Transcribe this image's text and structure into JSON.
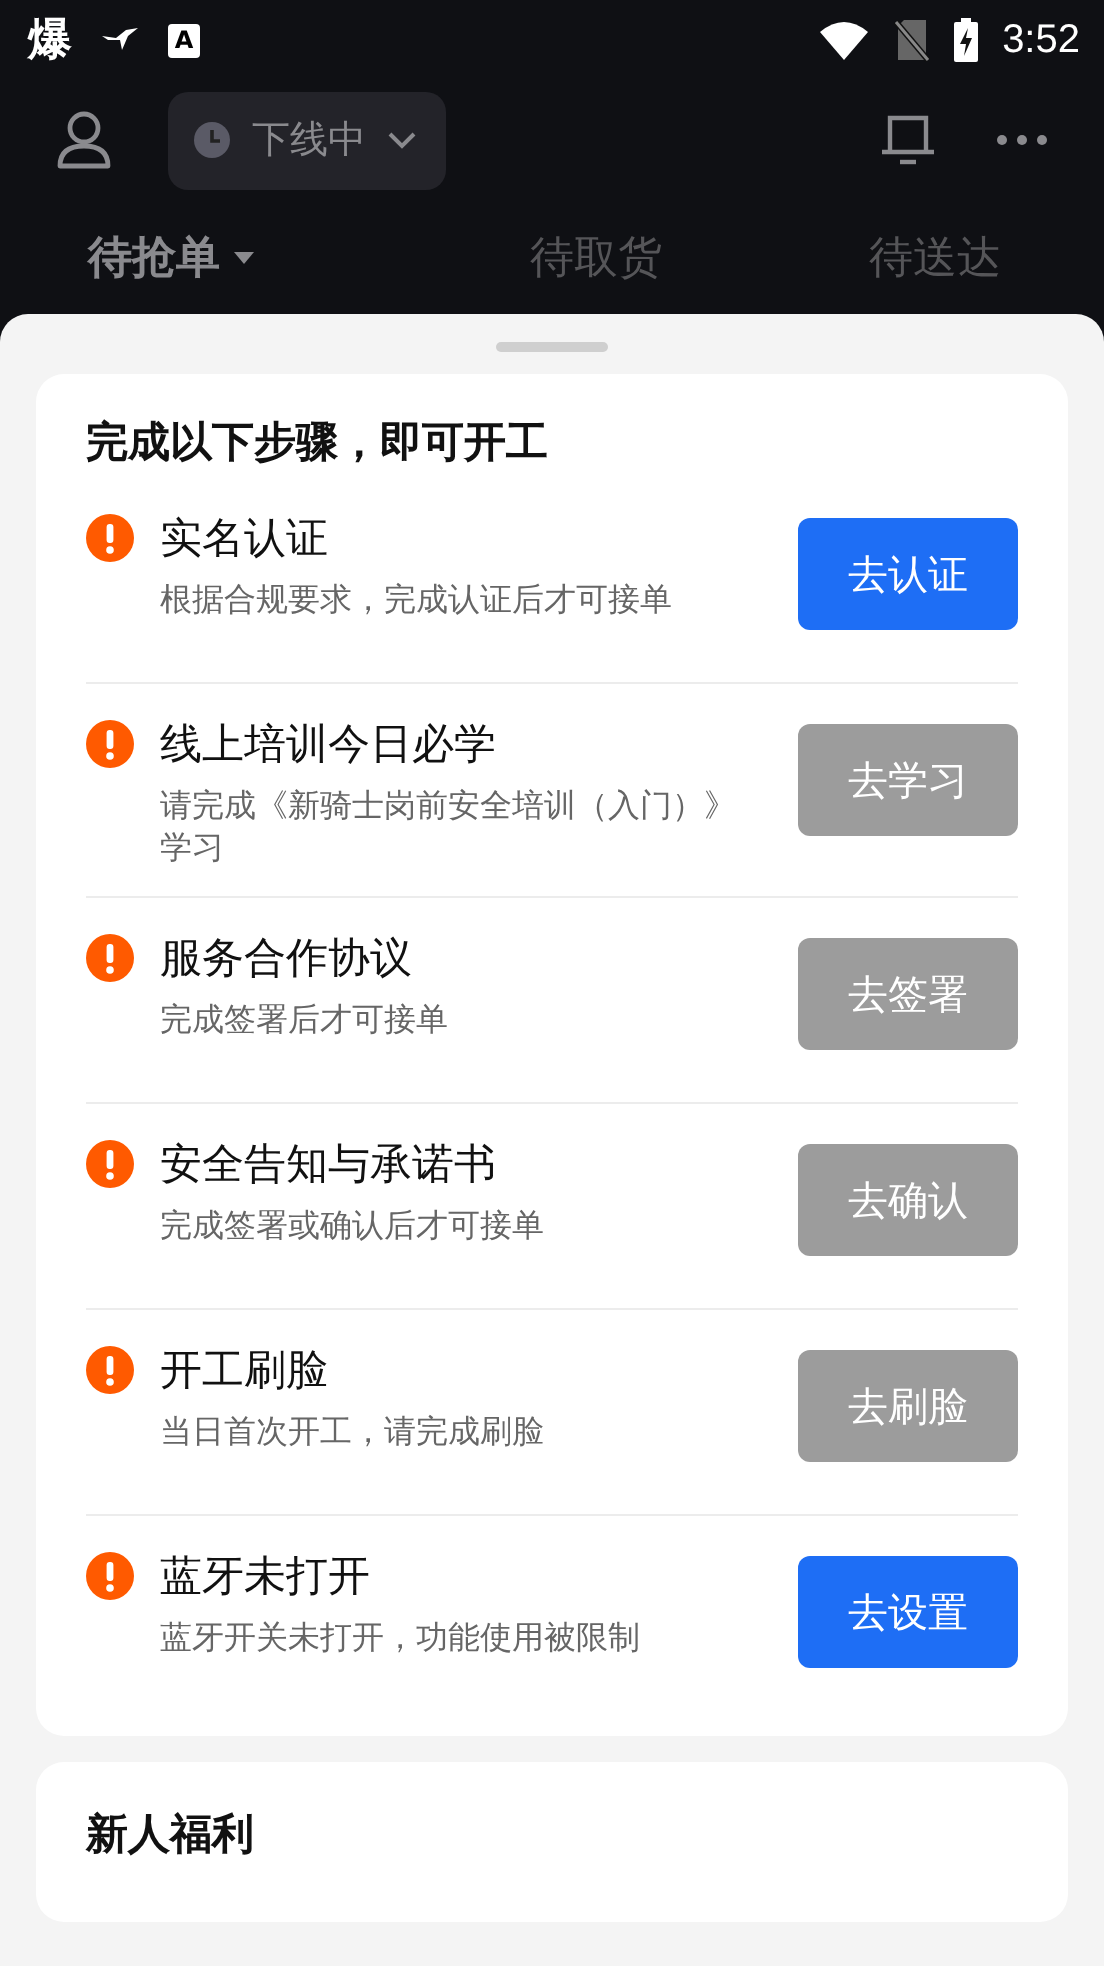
{
  "status_bar": {
    "notifications": [
      {
        "kind": "glyph",
        "text": "爆"
      },
      {
        "kind": "bird"
      },
      {
        "kind": "letter",
        "text": "A"
      }
    ],
    "time": "3:52"
  },
  "header": {
    "status": {
      "label": "下线中"
    }
  },
  "tabs": [
    {
      "label": "待抢单",
      "selected": true,
      "has_menu": true
    },
    {
      "label": "待取货",
      "selected": false,
      "has_menu": false
    },
    {
      "label": "待送达",
      "selected": false,
      "has_menu": false
    }
  ],
  "steps_card": {
    "title": "完成以下步骤，即可开工",
    "steps": [
      {
        "title": "实名认证",
        "description": "根据合规要求，完成认证后才可接单",
        "action": "去认证",
        "disabled": false
      },
      {
        "title": "线上培训今日必学",
        "description": "请完成《新骑士岗前安全培训（入门）》学习",
        "action": "去学习",
        "disabled": true
      },
      {
        "title": "服务合作协议",
        "description": "完成签署后才可接单",
        "action": "去签署",
        "disabled": true
      },
      {
        "title": "安全告知与承诺书",
        "description": "完成签署或确认后才可接单",
        "action": "去确认",
        "disabled": true
      },
      {
        "title": "开工刷脸",
        "description": "当日首次开工，请完成刷脸",
        "action": "去刷脸",
        "disabled": true
      },
      {
        "title": "蓝牙未打开",
        "description": "蓝牙开关未打开，功能使用被限制",
        "action": "去设置",
        "disabled": false
      }
    ]
  },
  "benefits_card": {
    "title": "新人福利"
  }
}
